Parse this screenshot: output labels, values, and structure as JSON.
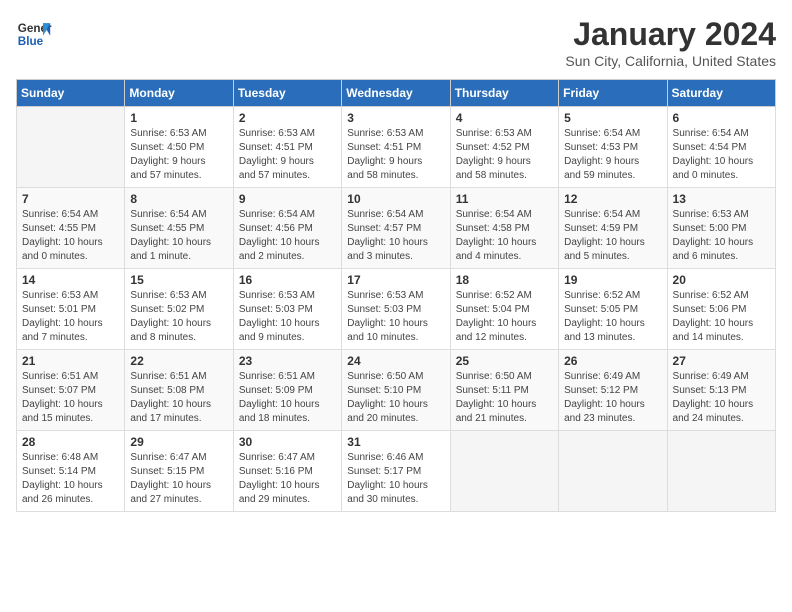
{
  "logo": {
    "line1": "General",
    "line2": "Blue"
  },
  "title": "January 2024",
  "location": "Sun City, California, United States",
  "weekdays": [
    "Sunday",
    "Monday",
    "Tuesday",
    "Wednesday",
    "Thursday",
    "Friday",
    "Saturday"
  ],
  "weeks": [
    [
      {
        "day": "",
        "info": ""
      },
      {
        "day": "1",
        "info": "Sunrise: 6:53 AM\nSunset: 4:50 PM\nDaylight: 9 hours\nand 57 minutes."
      },
      {
        "day": "2",
        "info": "Sunrise: 6:53 AM\nSunset: 4:51 PM\nDaylight: 9 hours\nand 57 minutes."
      },
      {
        "day": "3",
        "info": "Sunrise: 6:53 AM\nSunset: 4:51 PM\nDaylight: 9 hours\nand 58 minutes."
      },
      {
        "day": "4",
        "info": "Sunrise: 6:53 AM\nSunset: 4:52 PM\nDaylight: 9 hours\nand 58 minutes."
      },
      {
        "day": "5",
        "info": "Sunrise: 6:54 AM\nSunset: 4:53 PM\nDaylight: 9 hours\nand 59 minutes."
      },
      {
        "day": "6",
        "info": "Sunrise: 6:54 AM\nSunset: 4:54 PM\nDaylight: 10 hours\nand 0 minutes."
      }
    ],
    [
      {
        "day": "7",
        "info": "Sunrise: 6:54 AM\nSunset: 4:55 PM\nDaylight: 10 hours\nand 0 minutes."
      },
      {
        "day": "8",
        "info": "Sunrise: 6:54 AM\nSunset: 4:55 PM\nDaylight: 10 hours\nand 1 minute."
      },
      {
        "day": "9",
        "info": "Sunrise: 6:54 AM\nSunset: 4:56 PM\nDaylight: 10 hours\nand 2 minutes."
      },
      {
        "day": "10",
        "info": "Sunrise: 6:54 AM\nSunset: 4:57 PM\nDaylight: 10 hours\nand 3 minutes."
      },
      {
        "day": "11",
        "info": "Sunrise: 6:54 AM\nSunset: 4:58 PM\nDaylight: 10 hours\nand 4 minutes."
      },
      {
        "day": "12",
        "info": "Sunrise: 6:54 AM\nSunset: 4:59 PM\nDaylight: 10 hours\nand 5 minutes."
      },
      {
        "day": "13",
        "info": "Sunrise: 6:53 AM\nSunset: 5:00 PM\nDaylight: 10 hours\nand 6 minutes."
      }
    ],
    [
      {
        "day": "14",
        "info": "Sunrise: 6:53 AM\nSunset: 5:01 PM\nDaylight: 10 hours\nand 7 minutes."
      },
      {
        "day": "15",
        "info": "Sunrise: 6:53 AM\nSunset: 5:02 PM\nDaylight: 10 hours\nand 8 minutes."
      },
      {
        "day": "16",
        "info": "Sunrise: 6:53 AM\nSunset: 5:03 PM\nDaylight: 10 hours\nand 9 minutes."
      },
      {
        "day": "17",
        "info": "Sunrise: 6:53 AM\nSunset: 5:03 PM\nDaylight: 10 hours\nand 10 minutes."
      },
      {
        "day": "18",
        "info": "Sunrise: 6:52 AM\nSunset: 5:04 PM\nDaylight: 10 hours\nand 12 minutes."
      },
      {
        "day": "19",
        "info": "Sunrise: 6:52 AM\nSunset: 5:05 PM\nDaylight: 10 hours\nand 13 minutes."
      },
      {
        "day": "20",
        "info": "Sunrise: 6:52 AM\nSunset: 5:06 PM\nDaylight: 10 hours\nand 14 minutes."
      }
    ],
    [
      {
        "day": "21",
        "info": "Sunrise: 6:51 AM\nSunset: 5:07 PM\nDaylight: 10 hours\nand 15 minutes."
      },
      {
        "day": "22",
        "info": "Sunrise: 6:51 AM\nSunset: 5:08 PM\nDaylight: 10 hours\nand 17 minutes."
      },
      {
        "day": "23",
        "info": "Sunrise: 6:51 AM\nSunset: 5:09 PM\nDaylight: 10 hours\nand 18 minutes."
      },
      {
        "day": "24",
        "info": "Sunrise: 6:50 AM\nSunset: 5:10 PM\nDaylight: 10 hours\nand 20 minutes."
      },
      {
        "day": "25",
        "info": "Sunrise: 6:50 AM\nSunset: 5:11 PM\nDaylight: 10 hours\nand 21 minutes."
      },
      {
        "day": "26",
        "info": "Sunrise: 6:49 AM\nSunset: 5:12 PM\nDaylight: 10 hours\nand 23 minutes."
      },
      {
        "day": "27",
        "info": "Sunrise: 6:49 AM\nSunset: 5:13 PM\nDaylight: 10 hours\nand 24 minutes."
      }
    ],
    [
      {
        "day": "28",
        "info": "Sunrise: 6:48 AM\nSunset: 5:14 PM\nDaylight: 10 hours\nand 26 minutes."
      },
      {
        "day": "29",
        "info": "Sunrise: 6:47 AM\nSunset: 5:15 PM\nDaylight: 10 hours\nand 27 minutes."
      },
      {
        "day": "30",
        "info": "Sunrise: 6:47 AM\nSunset: 5:16 PM\nDaylight: 10 hours\nand 29 minutes."
      },
      {
        "day": "31",
        "info": "Sunrise: 6:46 AM\nSunset: 5:17 PM\nDaylight: 10 hours\nand 30 minutes."
      },
      {
        "day": "",
        "info": ""
      },
      {
        "day": "",
        "info": ""
      },
      {
        "day": "",
        "info": ""
      }
    ]
  ]
}
